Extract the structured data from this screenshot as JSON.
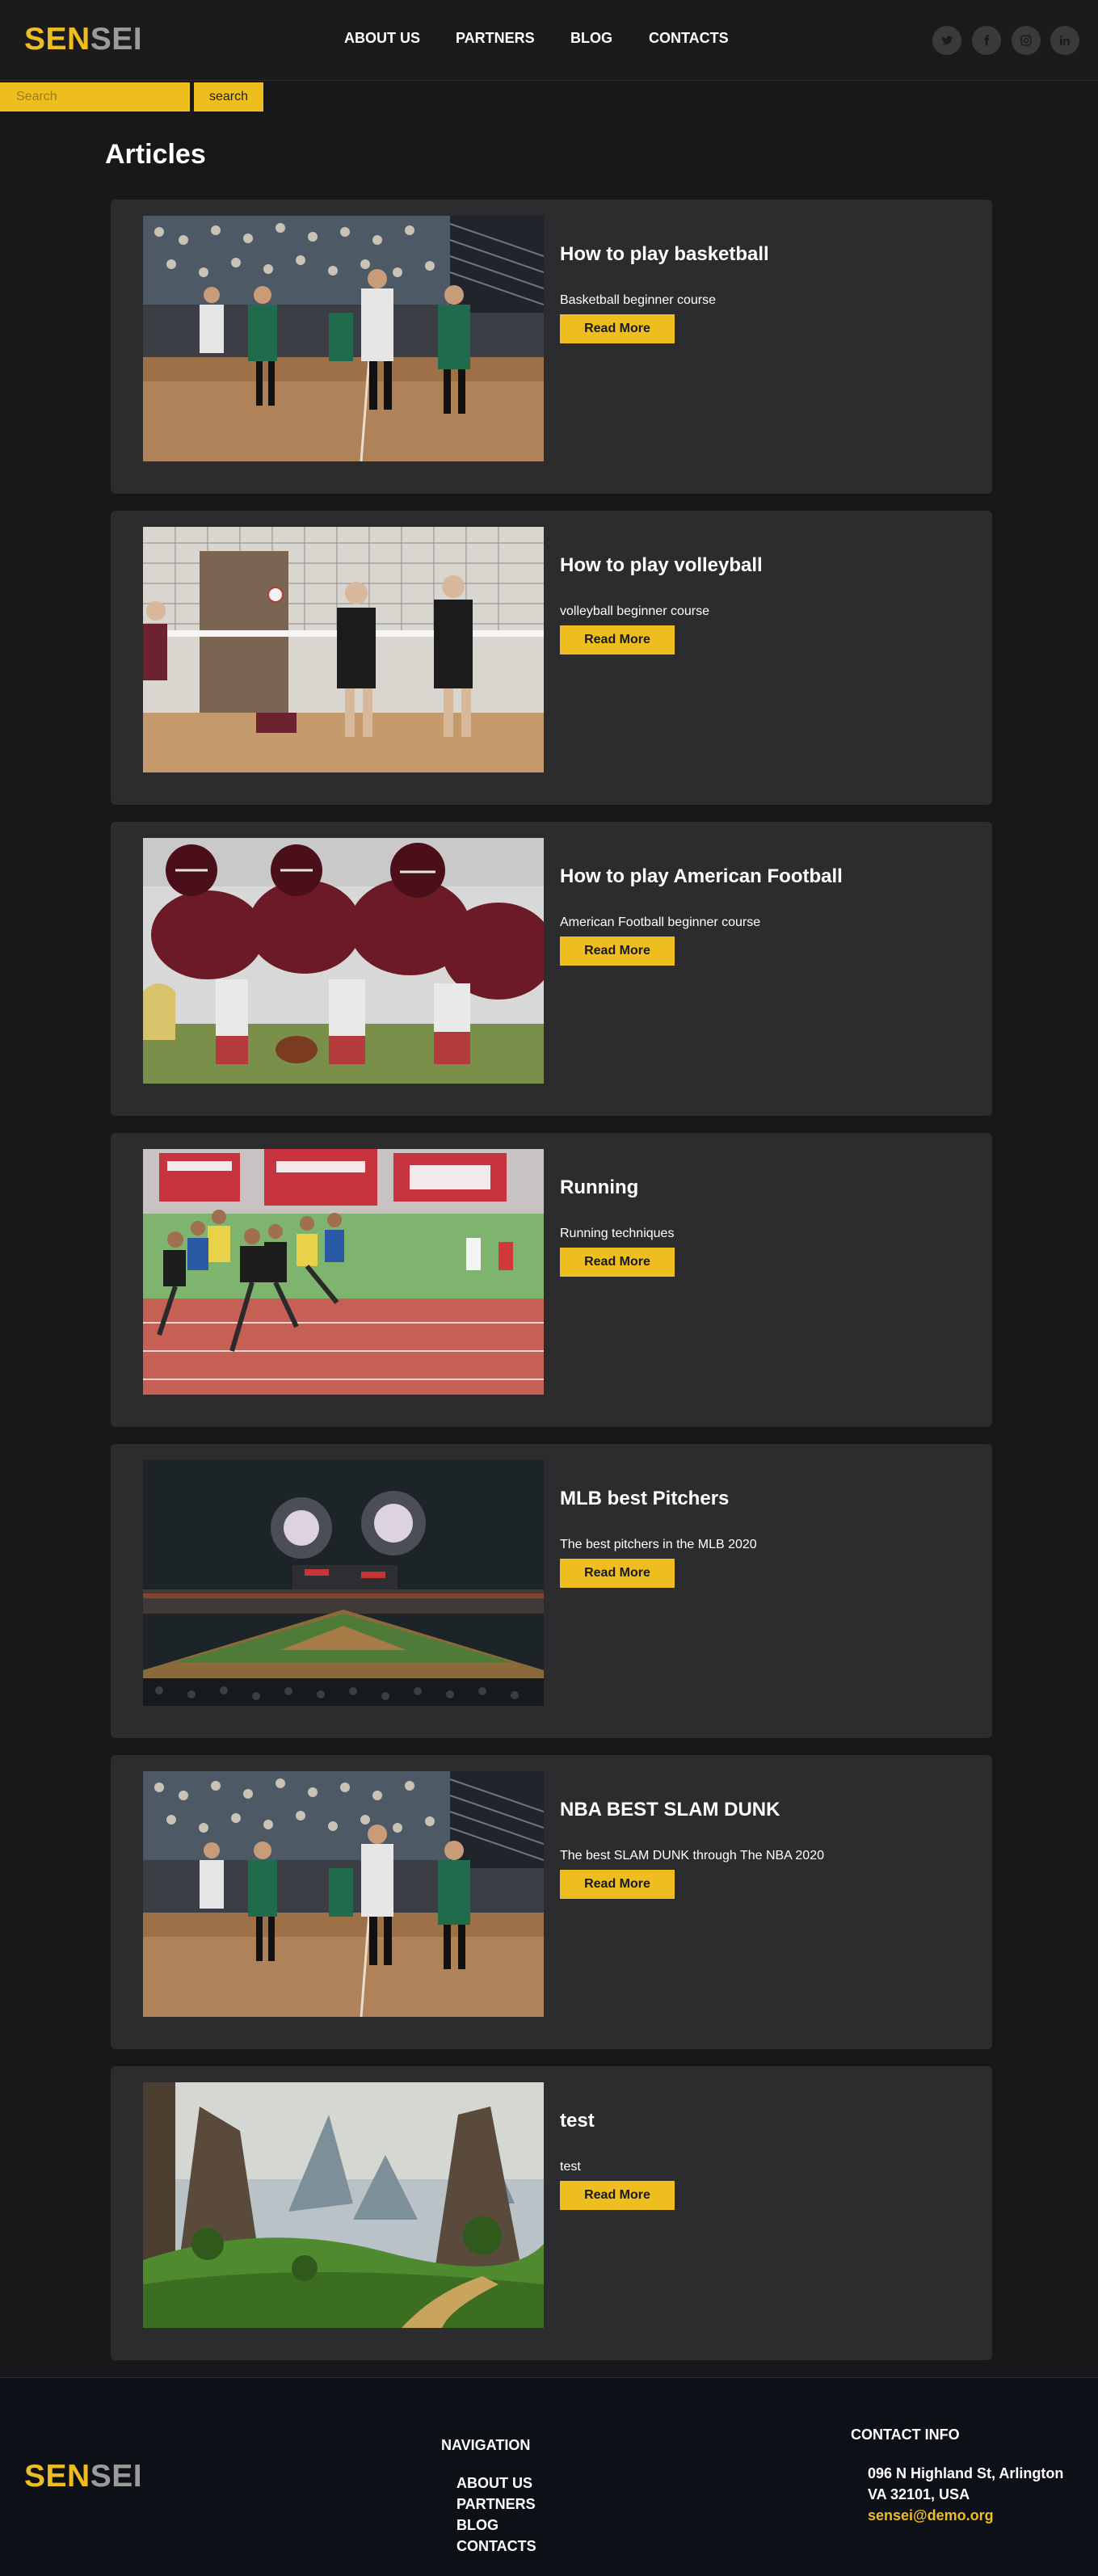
{
  "brand": {
    "part1": "SEN",
    "part2": "SEI"
  },
  "nav": {
    "items": [
      "ABOUT US",
      "PARTNERS",
      "BLOG",
      "CONTACTS"
    ]
  },
  "social": [
    "twitter-icon",
    "facebook-icon",
    "instagram-icon",
    "linkedin-icon"
  ],
  "search": {
    "placeholder": "Search",
    "button_label": "search"
  },
  "page_title": "Articles",
  "articles": [
    {
      "title": "How to play basketball",
      "description": "Basketball beginner course",
      "button": "Read More",
      "image": "basketball-photo"
    },
    {
      "title": "How to play volleyball",
      "description": "volleyball beginner course",
      "button": "Read More",
      "image": "volleyball-photo"
    },
    {
      "title": "How to play American Football",
      "description": "American Football beginner course",
      "button": "Read More",
      "image": "american-football-photo"
    },
    {
      "title": "Running",
      "description": "Running techniques",
      "button": "Read More",
      "image": "running-photo"
    },
    {
      "title": "MLB best Pitchers",
      "description": "The best pitchers in the MLB 2020",
      "button": "Read More",
      "image": "baseball-stadium-photo"
    },
    {
      "title": "NBA BEST SLAM DUNK",
      "description": "The best SLAM DUNK through The NBA 2020",
      "button": "Read More",
      "image": "basketball-photo"
    },
    {
      "title": "test",
      "description": "test",
      "button": "Read More",
      "image": "fantasy-landscape-photo"
    }
  ],
  "footer": {
    "navigation_heading": "NAVIGATION",
    "navigation_items": [
      "ABOUT US",
      "PARTNERS",
      "BLOG",
      "CONTACTS"
    ],
    "contact_heading": "CONTACT INFO",
    "address_line1": "096 N Highland St, Arlington",
    "address_line2": "VA 32101, USA",
    "email": "sensei@demo.org"
  },
  "colors": {
    "accent": "#eebd1f",
    "background": "#18181a",
    "card": "#2c2c2e",
    "footer": "#0d1016"
  }
}
